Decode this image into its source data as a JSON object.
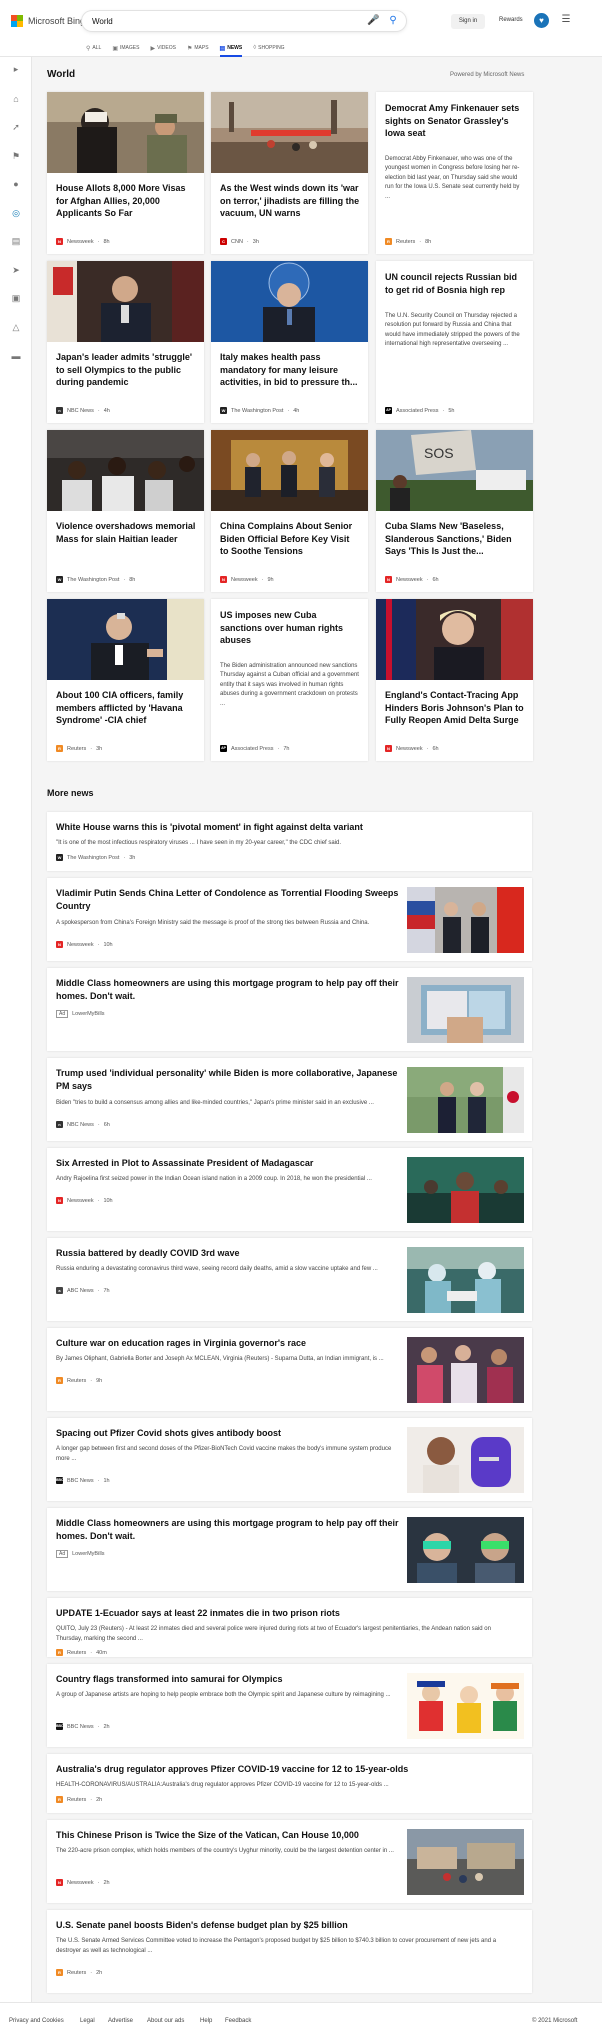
{
  "header": {
    "logo_text": "Microsoft Bing",
    "search_value": "World",
    "signin_label": "Sign in",
    "rewards_label": "Rewards",
    "tabs": [
      {
        "label": "ALL",
        "icon": "search-icon"
      },
      {
        "label": "IMAGES",
        "icon": "image-icon"
      },
      {
        "label": "VIDEOS",
        "icon": "video-icon"
      },
      {
        "label": "MAPS",
        "icon": "map-icon"
      },
      {
        "label": "NEWS",
        "icon": "news-icon"
      },
      {
        "label": "SHOPPING",
        "icon": "shopping-icon"
      }
    ],
    "active_tab": "NEWS",
    "accent_color": "#174ae4"
  },
  "section": {
    "title": "World",
    "powered_by": "Powered by Microsoft News"
  },
  "cards": [
    {
      "title": "House Allots 8,000 More Visas for Afghan Allies, 20,000 Applicants So Far",
      "snippet": "",
      "source": "Newsweek",
      "time": "8h",
      "has_image": true
    },
    {
      "title": "As the West winds down its 'war on terror,' jihadists are filling the vacuum, UN warns",
      "snippet": "",
      "source": "CNN",
      "time": "3h",
      "has_image": true
    },
    {
      "title": "Democrat Amy Finkenauer sets sights on Senator Grassley's Iowa seat",
      "snippet": "Democrat Abby Finkenauer, who was one of the youngest women in Congress before losing her re-election bid last year, on Thursday said she would run for the Iowa U.S. Senate seat currently held by ...",
      "source": "Reuters",
      "time": "8h",
      "has_image": false
    },
    {
      "title": "Japan's leader admits 'struggle' to sell Olympics to the public during pandemic",
      "snippet": "",
      "source": "NBC News",
      "time": "4h",
      "has_image": true
    },
    {
      "title": "Italy makes health pass mandatory for many leisure activities, in bid to pressure th...",
      "snippet": "",
      "source": "The Washington Post",
      "time": "4h",
      "has_image": true
    },
    {
      "title": "UN council rejects Russian bid to get rid of Bosnia high rep",
      "snippet": "The U.N. Security Council on Thursday rejected a resolution put forward by Russia and China that would have immediately stripped the powers of the international high representative overseeing ...",
      "source": "Associated Press",
      "time": "5h",
      "has_image": false
    },
    {
      "title": "Violence overshadows memorial Mass for slain Haitian leader",
      "snippet": "",
      "source": "The Washington Post",
      "time": "8h",
      "has_image": true
    },
    {
      "title": "China Complains About Senior Biden Official Before Key Visit to Soothe Tensions",
      "snippet": "",
      "source": "Newsweek",
      "time": "9h",
      "has_image": true
    },
    {
      "title": "Cuba Slams New 'Baseless, Slanderous Sanctions,' Biden Says 'This Is Just the...",
      "snippet": "",
      "source": "Newsweek",
      "time": "6h",
      "has_image": true
    },
    {
      "title": "About 100 CIA officers, family members afflicted by 'Havana Syndrome' -CIA chief",
      "snippet": "",
      "source": "Reuters",
      "time": "3h",
      "has_image": true
    },
    {
      "title": "US imposes new Cuba sanctions over human rights abuses",
      "snippet": "The Biden administration announced new sanctions Thursday against a Cuban official and a government entity that it says was involved in human rights abuses during a government crackdown on protests ...",
      "source": "Associated Press",
      "time": "7h",
      "has_image": false
    },
    {
      "title": "England's Contact-Tracing App Hinders Boris Johnson's Plan to Fully Reopen Amid Delta Surge",
      "snippet": "",
      "source": "Newsweek",
      "time": "6h",
      "has_image": true
    }
  ],
  "more_title": "More news",
  "more": [
    {
      "title": "White House warns this is 'pivotal moment' in fight against delta variant",
      "snippet": "\"It is one of the most infectious respiratory viruses ... I have seen in my 20-year career,\" the CDC chief said.",
      "source": "The Washington Post",
      "time": "3h",
      "ad": false
    },
    {
      "title": "Vladimir Putin Sends China Letter of Condolence as Torrential Flooding Sweeps Country",
      "snippet": "A spokesperson from China's Foreign Ministry said the message is proof of the strong ties between Russia and China.",
      "source": "Newsweek",
      "time": "10h",
      "ad": false
    },
    {
      "title": "Middle Class homeowners are using this mortgage program to help pay off their homes. Don't wait.",
      "snippet": "",
      "source": "LowerMyBills",
      "time": "",
      "ad": true
    },
    {
      "title": "Trump used 'individual personality' while Biden is more collaborative, Japanese PM says",
      "snippet": "Biden \"tries to build a consensus among allies and like-minded countries,\" Japan's prime minister said in an exclusive ...",
      "source": "NBC News",
      "time": "6h",
      "ad": false
    },
    {
      "title": "Six Arrested in Plot to Assassinate President of Madagascar",
      "snippet": "Andry Rajoelina first seized power in the Indian Ocean island nation in a 2009 coup. In 2018, he won the presidential ...",
      "source": "Newsweek",
      "time": "10h",
      "ad": false
    },
    {
      "title": "Russia battered by deadly COVID 3rd wave",
      "snippet": "Russia enduring a devastating coronavirus third wave, seeing record daily deaths, amid a slow vaccine uptake and few ...",
      "source": "ABC News",
      "time": "7h",
      "ad": false
    },
    {
      "title": "Culture war on education rages in Virginia governor's race",
      "snippet": "By James Oliphant, Gabriella Borter and Joseph Ax MCLEAN, Virginia (Reuters) - Suparna Dutta, an Indian immigrant, is ...",
      "source": "Reuters",
      "time": "9h",
      "ad": false
    },
    {
      "title": "Spacing out Pfizer Covid shots gives antibody boost",
      "snippet": "A longer gap between first and second doses of the Pfizer-BioNTech Covid vaccine makes the body's immune system produce more ...",
      "source": "BBC News",
      "time": "1h",
      "ad": false
    },
    {
      "title": "Middle Class homeowners are using this mortgage program to help pay off their homes. Don't wait.",
      "snippet": "",
      "source": "LowerMyBills",
      "time": "",
      "ad": true
    },
    {
      "title": "UPDATE 1-Ecuador says at least 22 inmates die in two prison riots",
      "snippet": "QUITO, July 23 (Reuters) - At least 22 inmates died and several police were injured during riots at two of Ecuador's largest penitentiaries, the Andean nation said on Thursday, marking the second ...",
      "source": "Reuters",
      "time": "40m",
      "ad": false
    },
    {
      "title": "Country flags transformed into samurai for Olympics",
      "snippet": "A group of Japanese artists are hoping to help people embrace both the Olympic spirit and Japanese culture by reimagining ...",
      "source": "BBC News",
      "time": "2h",
      "ad": false
    },
    {
      "title": "Australia's drug regulator approves Pfizer COVID-19 vaccine for 12 to 15-year-olds",
      "snippet": "HEALTH-CORONAVIRUS/AUSTRALIA:Australia's drug regulator approves Pfizer COVID-19 vaccine for 12 to 15-year-olds ...",
      "source": "Reuters",
      "time": "2h",
      "ad": false
    },
    {
      "title": "This Chinese Prison is Twice the Size of the Vatican, Can House 10,000",
      "snippet": "The 220-acre prison complex, which holds members of the country's Uyghur minority, could be the largest detention center in ...",
      "source": "Newsweek",
      "time": "2h",
      "ad": false
    },
    {
      "title": "U.S. Senate panel boosts Biden's defense budget plan by $25 billion",
      "snippet": "The U.S. Senate Armed Services Committee voted to increase the Pentagon's proposed budget by $25 billion to $740.3 billion to cover procurement of new jets and a destroyer as well as technological ...",
      "source": "Reuters",
      "time": "2h",
      "ad": false
    }
  ],
  "ad_label": "Ad",
  "footer": {
    "links": [
      "Privacy and Cookies",
      "Legal",
      "Advertise",
      "About our ads",
      "Help",
      "Feedback"
    ],
    "copyright": "© 2021 Microsoft"
  }
}
